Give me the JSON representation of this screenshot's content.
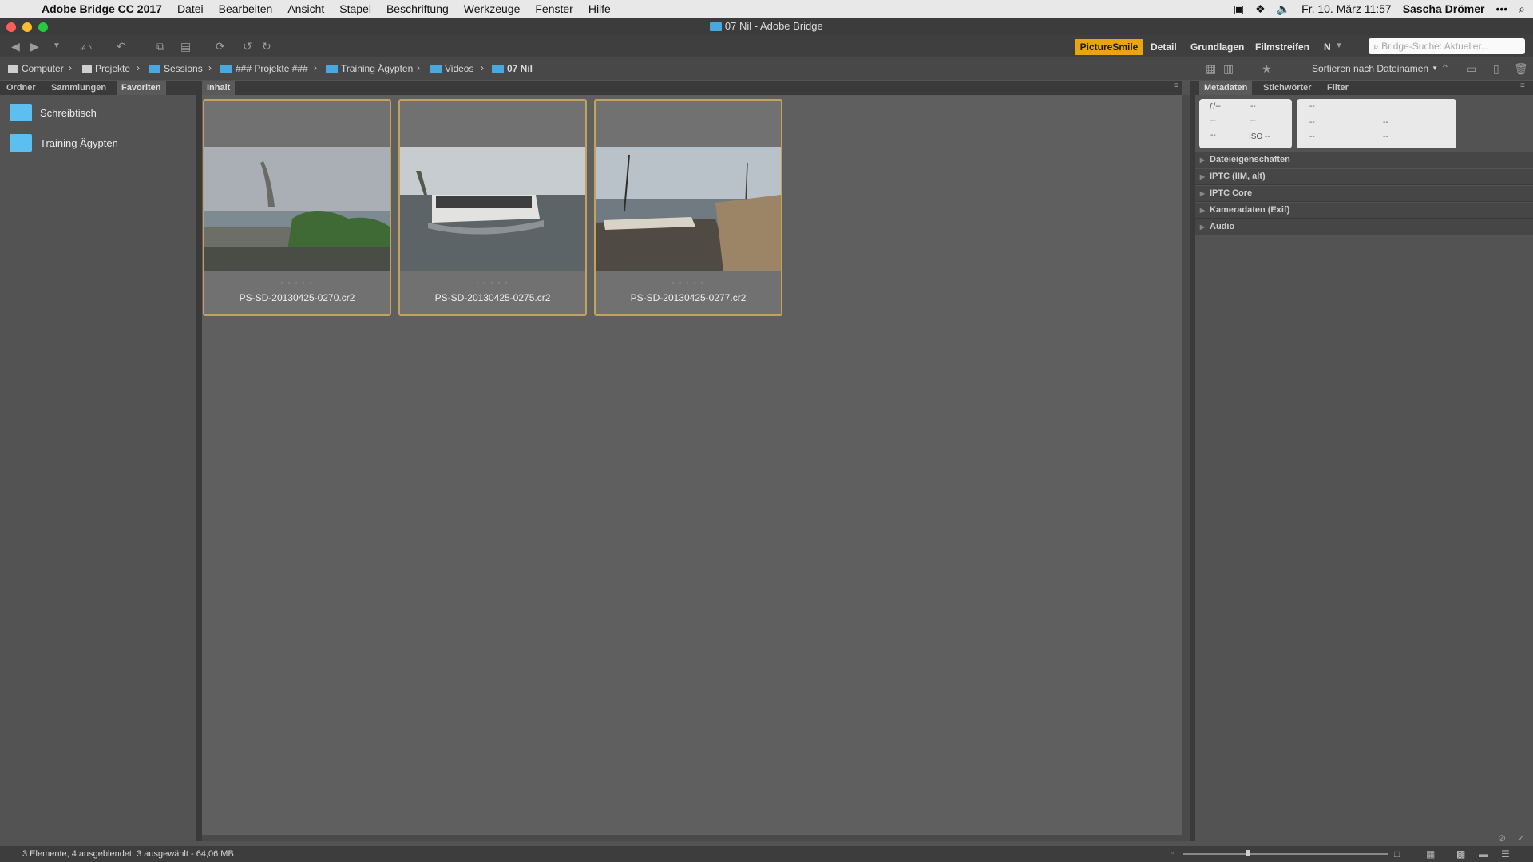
{
  "menubar": {
    "app": "Adobe Bridge CC 2017",
    "items": [
      "Datei",
      "Bearbeiten",
      "Ansicht",
      "Stapel",
      "Beschriftung",
      "Werkzeuge",
      "Fenster",
      "Hilfe"
    ],
    "datetime": "Fr. 10. März  11:57",
    "user": "Sascha Drömer",
    "more": "•••"
  },
  "window": {
    "title": "07 Nil - Adobe Bridge"
  },
  "workspaces": {
    "active": "PictureSmile",
    "items": [
      "Detail",
      "Grundlagen",
      "Filmstreifen",
      "N"
    ]
  },
  "search": {
    "placeholder": "Bridge-Suche: Aktueller..."
  },
  "breadcrumb": [
    "Computer",
    "Projekte",
    "Sessions",
    "### Projekte ###",
    "Training Ägypten",
    "Videos",
    "07 Nil"
  ],
  "sort": {
    "label": "Sortieren nach Dateinamen"
  },
  "left_panel": {
    "tabs": [
      "Ordner",
      "Sammlungen",
      "Favoriten"
    ],
    "active_tab": "Favoriten",
    "favorites": [
      "Schreibtisch",
      "Training Ägypten"
    ]
  },
  "content_panel": {
    "tab": "Inhalt",
    "thumbnails": [
      {
        "name": "PS-SD-20130425-0270.cr2"
      },
      {
        "name": "PS-SD-20130425-0275.cr2"
      },
      {
        "name": "PS-SD-20130425-0277.cr2"
      }
    ],
    "rating_dots": "• • • • •"
  },
  "right_panel": {
    "tabs": [
      "Metadaten",
      "Stichwörter",
      "Filter"
    ],
    "active_tab": "Metadaten",
    "exposure": {
      "aperture": "ƒ/--",
      "shutter": "--",
      "r2a": "--",
      "r2b": "--",
      "r3a": "--",
      "iso": "ISO --"
    },
    "camera": {
      "c1": "--",
      "c2": "--",
      "c3": "--",
      "c4": "--",
      "c5": "--"
    },
    "sections": [
      "Dateieigenschaften",
      "IPTC (IIM, alt)",
      "IPTC Core",
      "Kameradaten (Exif)",
      "Audio"
    ]
  },
  "status": {
    "text": "3 Elemente, 4 ausgeblendet, 3 ausgewählt - 64,06 MB"
  },
  "colors": {
    "accent": "#e8a50f",
    "selection_border": "#c3a25e",
    "folder": "#4aa8e0"
  }
}
